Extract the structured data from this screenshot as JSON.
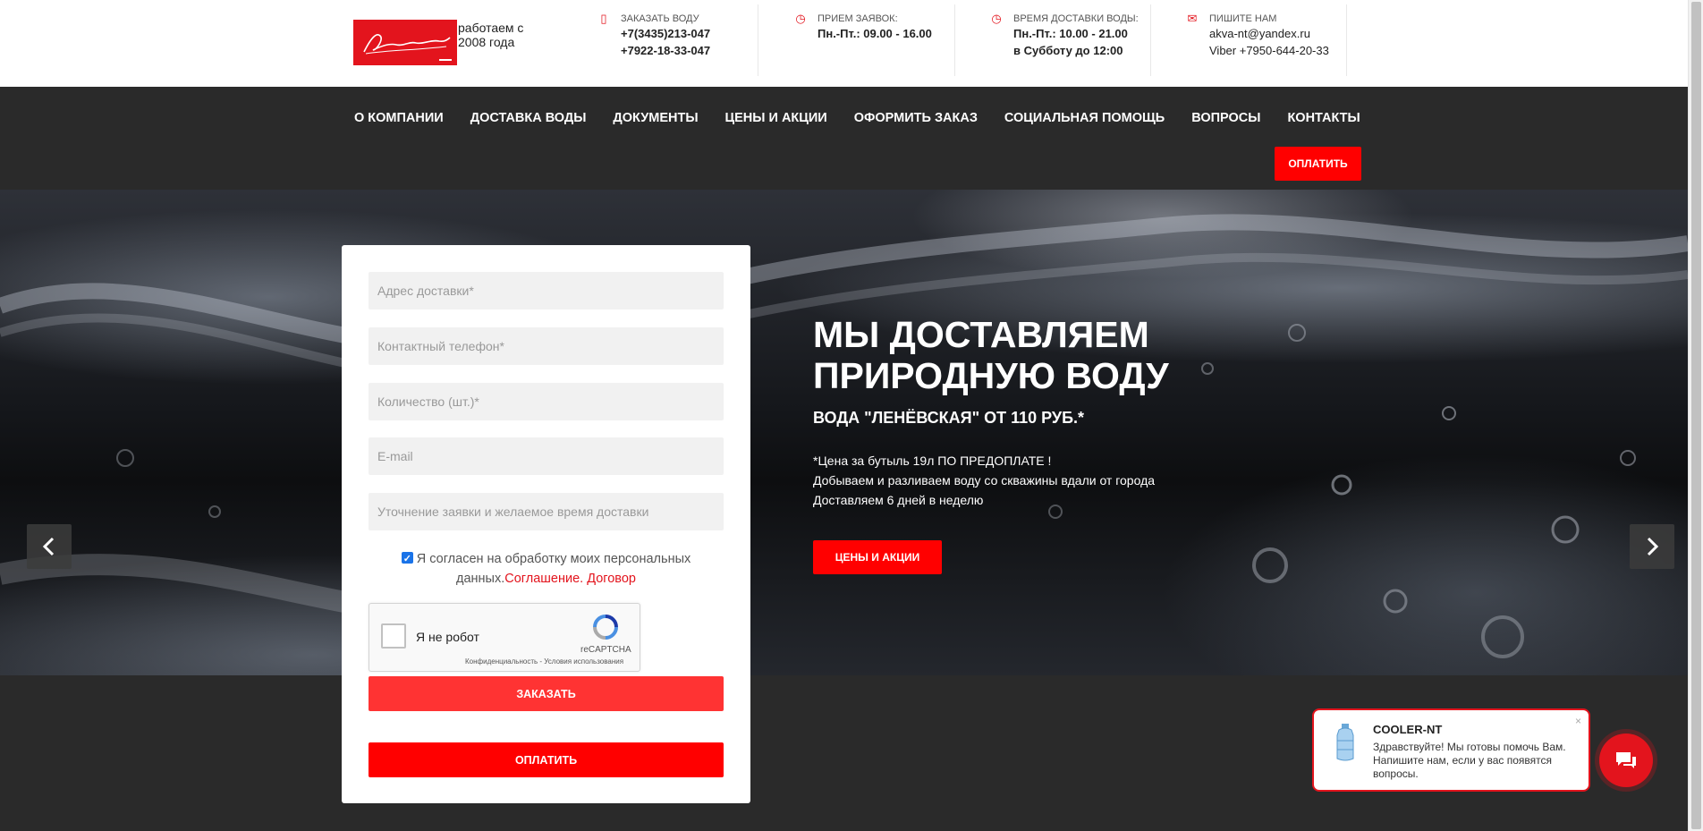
{
  "header": {
    "logo_text": "работаем с 2008 года",
    "blocks": [
      {
        "icon": "phone-icon",
        "label": "ЗАКАЗАТЬ ВОДУ",
        "lines": [
          "+7(3435)213-047",
          "+7922-18-33-047"
        ]
      },
      {
        "icon": "clock-icon",
        "label": "ПРИЕМ ЗАЯВОК:",
        "lines": [
          "Пн.-Пт.: 09.00 - 16.00"
        ]
      },
      {
        "icon": "clock-icon",
        "label": "ВРЕМЯ ДОСТАВКИ ВОДЫ:",
        "lines": [
          "Пн.-Пт.: 10.00 - 21.00",
          "в Субботу до 12:00"
        ]
      },
      {
        "icon": "mail-icon",
        "label": "ПИШИТЕ НАМ",
        "lines": [
          "akva-nt@yandex.ru",
          "Viber +7950-644-20-33"
        ]
      }
    ]
  },
  "nav": {
    "items": [
      "О КОМПАНИИ",
      "ДОСТАВКА ВОДЫ",
      "ДОКУМЕНТЫ",
      "ЦЕНЫ И АКЦИИ",
      "ОФОРМИТЬ ЗАКАЗ",
      "СОЦИАЛЬНАЯ ПОМОЩЬ",
      "ВОПРОСЫ",
      "КОНТАКТЫ"
    ],
    "pay_label": "ОПЛАТИТЬ"
  },
  "form": {
    "address_placeholder": "Адрес доставки*",
    "phone_placeholder": "Контактный телефон*",
    "quantity_placeholder": "Количество (шт.)*",
    "email_placeholder": "E-mail",
    "comment_placeholder": "Уточнение заявки и желаемое время доставки",
    "consent_text": "Я согласен на обработку моих персональных данных.",
    "consent_link1": "Соглашение.",
    "consent_link2": "Договор",
    "recaptcha_label": "Я не робот",
    "recaptcha_brand": "reCAPTCHA",
    "recaptcha_terms": "Конфиденциальность - Условия использования",
    "order_label": "ЗАКАЗАТЬ",
    "pay_label": "ОПЛАТИТЬ"
  },
  "hero": {
    "title": "МЫ ДОСТАВЛЯЕМ ПРИРОДНУЮ ВОДУ",
    "subtitle": "ВОДА \"ЛЕНЁВСКАЯ\" ОТ 110 РУБ.*",
    "line1": "*Цена за бутыль 19л ПО ПРЕДОПЛАТЕ !",
    "line2": "Добываем и разливаем воду со скважины вдали от города",
    "line3": "Доставляем 6 дней в неделю",
    "button": "ЦЕНЫ И АКЦИИ"
  },
  "chat": {
    "name": "COOLER-NT",
    "message": "Здравствуйте! Мы готовы помочь Вам. Напишите нам, если у вас появятся вопросы.",
    "close": "×"
  },
  "colors": {
    "accent": "#ff0000",
    "brand": "#e3141d",
    "nav_bg": "#2a2a2a"
  }
}
